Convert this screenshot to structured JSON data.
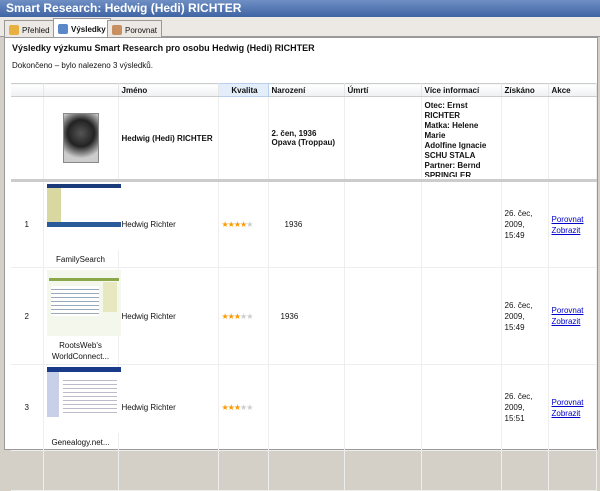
{
  "window": {
    "title": "Smart Research: Hedwig (Hedi) RICHTER"
  },
  "tabs": [
    {
      "label": "Přehled",
      "icon": "overview-icon"
    },
    {
      "label": "Výsledky",
      "icon": "results-icon",
      "active": true
    },
    {
      "label": "Porovnat",
      "icon": "compare-icon"
    }
  ],
  "heading": "Výsledky výzkumu Smart Research pro osobu Hedwig (Hedi) RICHTER",
  "status": "Dokončeno – bylo nalezeno 3 výsledků.",
  "columns": [
    "",
    "",
    "Jméno",
    "Kvalita",
    "Narození",
    "Úmrtí",
    "Více informací",
    "Získáno",
    "Akce"
  ],
  "person": {
    "name": "Hedwig (Hedi) RICHTER",
    "birth_date": "2. čen, 1936",
    "birth_place": "Opava (Troppau)",
    "death": "",
    "more": [
      "Otec: Ernst RICHTER",
      "Matka: Helene Marie",
      "Adolfine Ignacie",
      "SCHU STALA",
      "Partner: Bernd",
      "SPRINGLER"
    ]
  },
  "results": [
    {
      "num": "1",
      "source": "FamilySearch",
      "name": "Hedwig Richter",
      "stars": 4,
      "birth": "1936",
      "obtained_1": "26. čec,",
      "obtained_2": "2009, 15:49",
      "compare": "Porovnat",
      "view": "Zobrazit"
    },
    {
      "num": "2",
      "source": "RootsWeb's WorldConnect...",
      "name": "Hedwig Richter",
      "stars": 3,
      "birth": "1936",
      "obtained_1": "26. čec,",
      "obtained_2": "2009, 15:49",
      "compare": "Porovnat",
      "view": "Zobrazit"
    },
    {
      "num": "3",
      "source": "Genealogy.net...",
      "name": "Hedwig Richter",
      "stars": 3,
      "birth": "",
      "obtained_1": "26. čec,",
      "obtained_2": "2009, 15:51",
      "compare": "Porovnat",
      "view": "Zobrazit"
    }
  ],
  "max_stars": 5
}
